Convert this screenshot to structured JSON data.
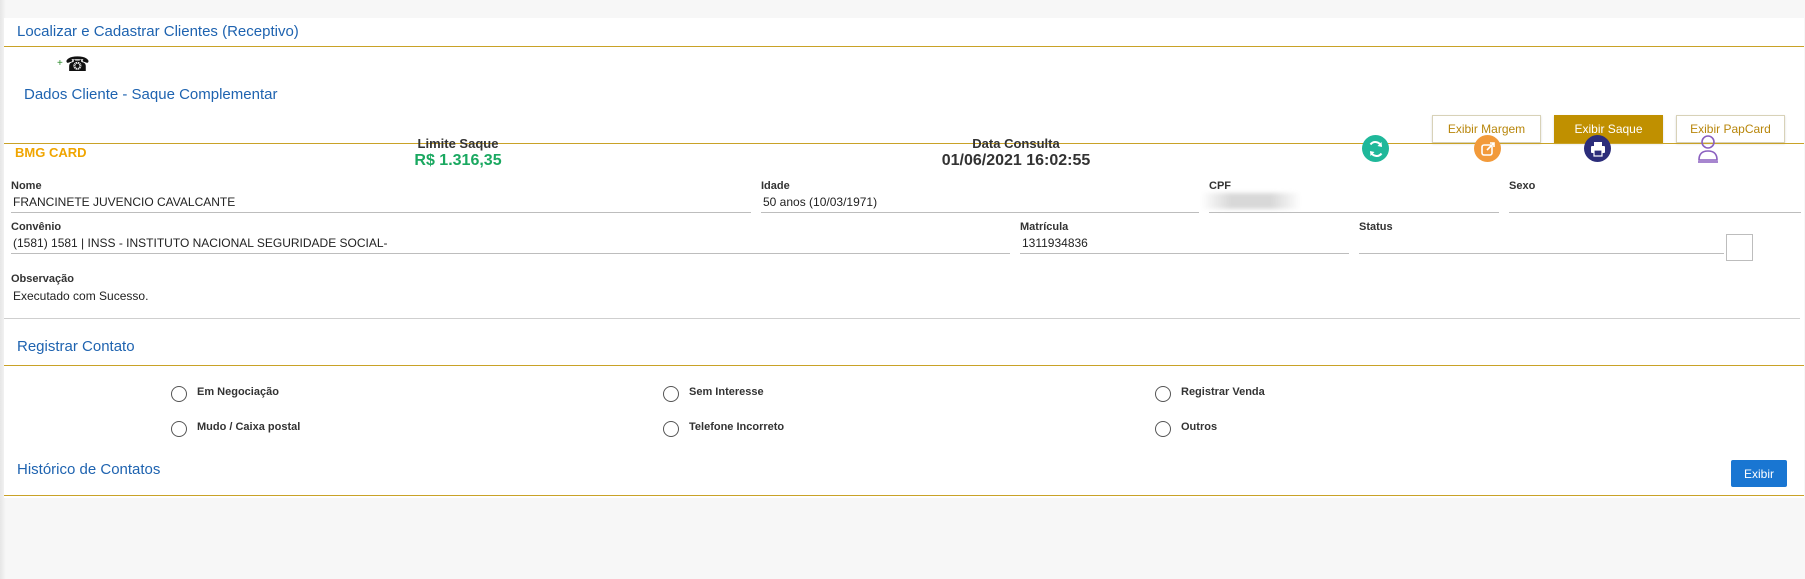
{
  "page": {
    "title": "Localizar e Cadastrar Clientes (Receptivo)",
    "phone_icon_prefix": "+",
    "phone_icon": "phone-icon"
  },
  "dados": {
    "title": "Dados Cliente - Saque Complementar",
    "tabs": [
      {
        "label": "Exibir Margem",
        "active": false
      },
      {
        "label": "Exibir Saque",
        "active": true
      },
      {
        "label": "Exibir PapCard",
        "active": false
      }
    ]
  },
  "summary": {
    "brand": "BMG CARD",
    "limite_label": "Limite Saque",
    "limite_value": "R$ 1.316,35",
    "data_label": "Data Consulta",
    "data_value": "01/06/2021 16:02:55",
    "icons": [
      "refresh-icon",
      "share-icon",
      "print-icon",
      "user-stamp-icon"
    ]
  },
  "fields": {
    "nome_label": "Nome",
    "nome_value": "FRANCINETE JUVENCIO CAVALCANTE",
    "idade_label": "Idade",
    "idade_value": "50 anos (10/03/1971)",
    "cpf_label": "CPF",
    "sexo_label": "Sexo",
    "convenio_label": "Convênio",
    "convenio_value": "(1581) 1581 | INSS - INSTITUTO NACIONAL SEGURIDADE SOCIAL-",
    "matricula_label": "Matrícula",
    "matricula_value": "1311934836",
    "status_label": "Status",
    "observacao_label": "Observação",
    "observacao_value": "Executado com Sucesso."
  },
  "registrar": {
    "title": "Registrar Contato",
    "options": [
      "Em Negociação",
      "Sem Interesse",
      "Registrar Venda",
      "Mudo / Caixa postal",
      "Telefone Incorreto",
      "Outros"
    ]
  },
  "historico": {
    "title": "Histórico de Contatos",
    "button": "Exibir"
  },
  "colors": {
    "accent_gold": "#c9a227",
    "title_blue": "#1e63b0",
    "brand_orange": "#f0a500",
    "value_green": "#1aa860",
    "button_blue": "#1976d2"
  }
}
